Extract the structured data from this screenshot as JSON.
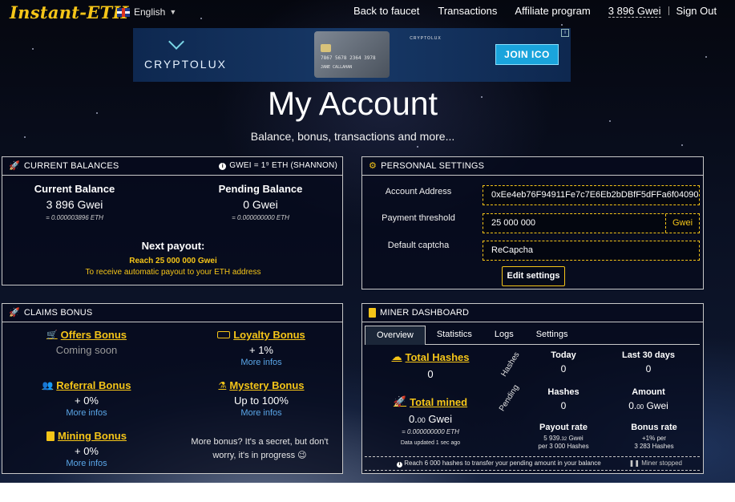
{
  "header": {
    "logo": "Instant-ETH",
    "language": "English",
    "nav": {
      "back_to_faucet": "Back to faucet",
      "transactions": "Transactions",
      "affiliate": "Affiliate program",
      "balance": "3 896 Gwei",
      "sign_out": "Sign Out"
    }
  },
  "banner": {
    "brand": "CRYPTOLUX",
    "card_brand": "CRYPTOLUX",
    "card_number": "7867 5678 2364 3978",
    "card_holder": "JANE CALLAHAN",
    "cta": "JOIN ICO"
  },
  "page": {
    "title": "My Account",
    "subtitle": "Balance, bonus, transactions and more..."
  },
  "balances": {
    "header": "CURRENT BALANCES",
    "unit_note": "GWEI = 1⁹ ETH (SHANNON)",
    "current": {
      "title": "Current Balance",
      "value": "3 896 Gwei",
      "eth": "= 0.000003896 ETH"
    },
    "pending": {
      "title": "Pending Balance",
      "value": "0 Gwei",
      "eth": "= 0.000000000 ETH"
    },
    "next_payout": {
      "title": "Next payout:",
      "reach": "Reach 25 000 000 Gwei",
      "note": "To receive automatic payout to your ETH address"
    }
  },
  "settings": {
    "header": "PERSONNAL SETTINGS",
    "account_address": {
      "label": "Account Address",
      "value": "0xEe4eb76F94911Fe7c7E6Eb2bDBfF5dFFa6f04090"
    },
    "payment_threshold": {
      "label": "Payment threshold",
      "value": "25 000 000",
      "unit": "Gwei"
    },
    "default_captcha": {
      "label": "Default captcha",
      "value": "ReCapcha"
    },
    "edit_button": "Edit settings"
  },
  "claims": {
    "header": "CLAIMS BONUS",
    "offers": {
      "title": "Offers Bonus",
      "value": "Coming soon"
    },
    "loyalty": {
      "title": "Loyalty Bonus",
      "value": "+ 1%",
      "link": "More infos"
    },
    "referral": {
      "title": "Referral Bonus",
      "value": "+ 0%",
      "link": "More infos"
    },
    "mystery": {
      "title": "Mystery Bonus",
      "value": "Up to 100%",
      "link": "More infos"
    },
    "mining": {
      "title": "Mining Bonus",
      "value": "+ 0%",
      "link": "More infos"
    },
    "more_bonus": "More bonus? It's a secret, but don't worry, it's in progress 😉"
  },
  "miner": {
    "header": "MINER DASHBOARD",
    "tabs": [
      "Overview",
      "Statistics",
      "Logs",
      "Settings"
    ],
    "total_hashes": {
      "title": "Total Hashes",
      "value": "0"
    },
    "total_mined": {
      "title": "Total mined",
      "value_main": "0.",
      "value_small": "00",
      "value_unit": " Gwei",
      "eth": "= 0.000000000 ETH",
      "updated": "Data updated 1 sec ago"
    },
    "hashes_label": "Hashes",
    "pending_label": "Pending",
    "today": {
      "label": "Today",
      "value": "0"
    },
    "last30": {
      "label": "Last 30 days",
      "value": "0"
    },
    "hashes": {
      "label": "Hashes",
      "value": "0"
    },
    "amount": {
      "label": "Amount",
      "value_main": "0.",
      "value_small": "00",
      "value_unit": " Gwei"
    },
    "payout_rate": {
      "label": "Payout rate",
      "value_main": "5 939.",
      "value_small": "32",
      "value_unit": " Gwei",
      "sub": "per 3 000 Hashes"
    },
    "bonus_rate": {
      "label": "Bonus rate",
      "value": "+1% per",
      "sub": "3 283 Hashes"
    },
    "footer_note": "Reach 6 000 hashes to transfer your pending amount in your balance",
    "status": "Miner stopped"
  },
  "colors": {
    "accent": "#f5c518",
    "link": "#5aa6e8",
    "panel_border": "#c8c8c8"
  }
}
